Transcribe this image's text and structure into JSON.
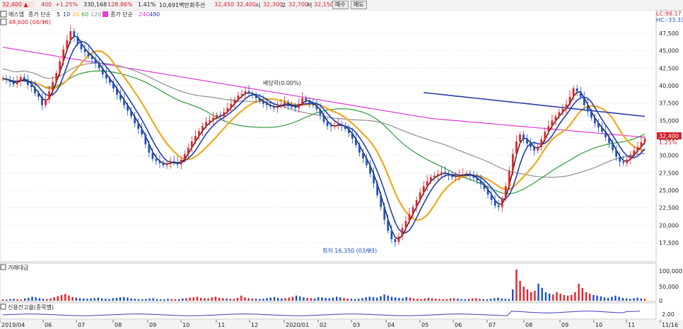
{
  "topbar": {
    "price": "32,400 ▲",
    "change": "400",
    "change_pct": "+1.25%",
    "volume": "330,168",
    "vol_ratio": "128.86%",
    "turnover_pct": "1.41%",
    "value": "10,691백만",
    "prev_label": "회주선",
    "prev_val": "32,450",
    "open_val": "32,400",
    "open_label": "시",
    "open2": "32,300",
    "high_label": "고",
    "high_val": "32,700",
    "low_label": "저",
    "low_val": "32,150",
    "buy_btn": "매수",
    "sell_btn": "매도"
  },
  "colors": {
    "up": "#e8202a",
    "down": "#1a4fd0",
    "ma5": "#1a1a1a",
    "ma10": "#1e3fae",
    "ma20": "#f0a81e",
    "ma60": "#2e9b3a",
    "ma120": "#8f8f8f",
    "ma240": "#e23bd1",
    "ma480": "#2b3fa8",
    "grid": "#dcdcdc"
  },
  "chart_data": {
    "type": "candlestick",
    "legend": {
      "title": "에스엠",
      "ma_label": "종가 단순",
      "periods_a": [
        "5",
        "10",
        "20",
        "60",
        "120"
      ],
      "ma_label2": "종가 단순",
      "periods_b": [
        "240",
        "480"
      ]
    },
    "high_note": "48,600 (06/10)",
    "low_note": "최저 16,350 (03/23)",
    "div_note": "배당락(0.00%)",
    "lc_note": "LC:98.17",
    "hc_note": "HC:-33.33",
    "last_price": "32,400",
    "last_pct": "1.25%",
    "y_ticks": [
      "47,500",
      "45,000",
      "42,500",
      "40,000",
      "37,500",
      "35,000",
      "32,500",
      "30,000",
      "27,500",
      "25,000",
      "22,500",
      "20,000",
      "17,500"
    ],
    "y_values": [
      47500,
      45000,
      42500,
      40000,
      37500,
      35000,
      32500,
      30000,
      27500,
      25000,
      22500,
      20000,
      17500
    ],
    "x_labels": [
      "2019/04",
      "06",
      "07",
      "08",
      "09",
      "10",
      "11",
      "12",
      "2020/01",
      "02",
      "03",
      "04",
      "05",
      "06",
      "07",
      "08",
      "09",
      "10",
      "11",
      "11/16"
    ],
    "volume_panel": {
      "title": "거래대금",
      "ticks": [
        "100,000",
        "50,000",
        "0"
      ]
    },
    "credit_panel": {
      "title": "신용잔고율(종목별)",
      "ticks": [
        "2.00"
      ]
    },
    "price_series": [
      41000,
      40800,
      40500,
      40200,
      40600,
      41200,
      40900,
      40100,
      39800,
      38900,
      38400,
      37200,
      38000,
      39200,
      40500,
      41800,
      43500,
      45200,
      46500,
      47800,
      47000,
      46000,
      45200,
      44800,
      44200,
      43800,
      43200,
      42500,
      41600,
      41000,
      40400,
      39600,
      38700,
      38000,
      37200,
      36400,
      35600,
      34600,
      33800,
      33000,
      31600,
      30400,
      29500,
      29200,
      28900,
      28600,
      28800,
      29200,
      29000,
      28700,
      29400,
      30200,
      31100,
      32000,
      32800,
      33500,
      34200,
      34800,
      35000,
      35400,
      35800,
      35600,
      36200,
      36800,
      37400,
      38000,
      38600,
      38800,
      39200,
      38900,
      38600,
      38200,
      37800,
      37400,
      37200,
      37000,
      36800,
      37100,
      37300,
      37600,
      37200,
      36900,
      36800,
      37400,
      38200,
      37800,
      37500,
      37200,
      36600,
      35800,
      34800,
      34200,
      34100,
      34300,
      34500,
      34200,
      33800,
      33200,
      32400,
      31500,
      30400,
      29600,
      28600,
      27400,
      26000,
      24300,
      22600,
      20800,
      19200,
      18000,
      17600,
      18400,
      19600,
      20600,
      21600,
      22600,
      23600,
      24700,
      25600,
      26300,
      26900,
      27100,
      27300,
      27600,
      27400,
      27100,
      26900,
      27000,
      27200,
      27300,
      27400,
      27100,
      26800,
      26400,
      25900,
      25200,
      24400,
      23600,
      22800,
      22600,
      23800,
      25600,
      27800,
      30200,
      32000,
      33000,
      32400,
      31700,
      31200,
      30700,
      31200,
      32300,
      33400,
      34200,
      35000,
      35600,
      36200,
      36700,
      37300,
      38400,
      39600,
      39200,
      38400,
      37200,
      36300,
      35400,
      34600,
      34000,
      33400,
      32600,
      31800,
      30800,
      29800,
      29100,
      28900,
      29400,
      30100,
      30700,
      31200,
      31900,
      32400
    ],
    "volume_series": [
      5,
      4,
      6,
      7,
      5,
      4,
      8,
      10,
      14,
      12,
      9,
      7,
      6,
      8,
      12,
      16,
      20,
      24,
      18,
      13,
      11,
      9,
      8,
      7,
      8,
      9,
      11,
      8,
      7,
      6,
      9,
      10,
      12,
      13,
      11,
      8,
      7,
      6,
      5,
      6,
      8,
      9,
      6,
      5,
      5,
      7,
      6,
      5,
      6,
      8,
      9,
      11,
      12,
      14,
      10,
      9,
      8,
      12,
      14,
      10,
      9,
      8,
      7,
      6,
      10,
      18,
      12,
      9,
      8,
      7,
      6,
      7,
      9,
      11,
      13,
      10,
      8,
      9,
      11,
      14,
      18,
      15,
      12,
      10,
      9,
      8,
      13,
      12,
      10,
      9,
      11,
      14,
      12,
      9,
      8,
      7,
      6,
      7,
      9,
      12,
      14,
      13,
      11,
      16,
      22,
      18,
      14,
      12,
      10,
      9,
      13,
      11,
      8,
      7,
      6,
      8,
      10,
      9,
      7,
      6,
      5,
      6,
      8,
      9,
      7,
      6,
      5,
      7,
      8,
      9,
      7,
      6,
      5,
      7,
      9,
      11,
      8,
      7,
      6,
      40,
      110,
      70,
      50,
      40,
      30,
      35,
      60,
      45,
      30,
      25,
      22,
      30,
      25,
      20,
      18,
      20,
      30,
      60,
      45,
      30,
      25,
      20,
      18,
      15,
      12,
      10,
      14,
      18,
      14,
      10,
      8,
      7,
      9,
      11,
      8,
      7
    ]
  }
}
